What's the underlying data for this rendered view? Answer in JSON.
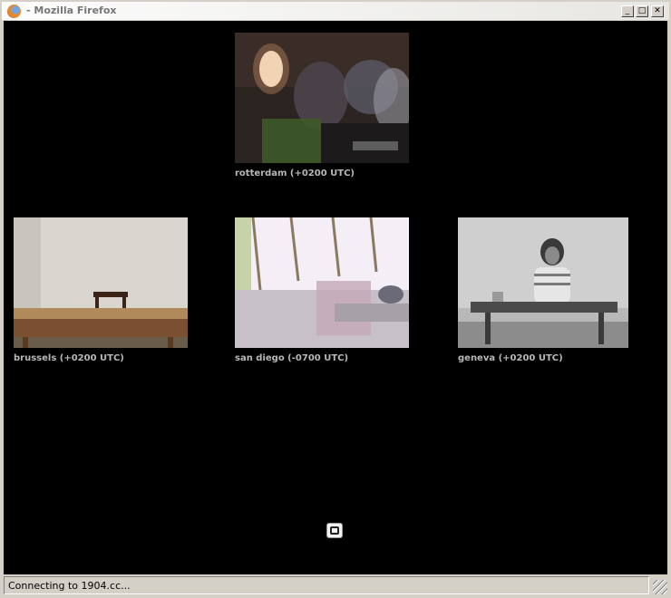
{
  "window": {
    "title": "- Mozilla Firefox"
  },
  "controls": {
    "minimize": "_",
    "maximize": "□",
    "close": "✕"
  },
  "tiles": [
    {
      "caption": "rotterdam (+0200 UTC)"
    },
    {
      "caption": "brussels (+0200 UTC)"
    },
    {
      "caption": "san diego (-0700 UTC)"
    },
    {
      "caption": "geneva (+0200 UTC)"
    }
  ],
  "icons": {
    "fullscreen": "fullscreen-icon",
    "app": "firefox-icon"
  },
  "status": {
    "text": "Connecting to 1904.cc..."
  }
}
